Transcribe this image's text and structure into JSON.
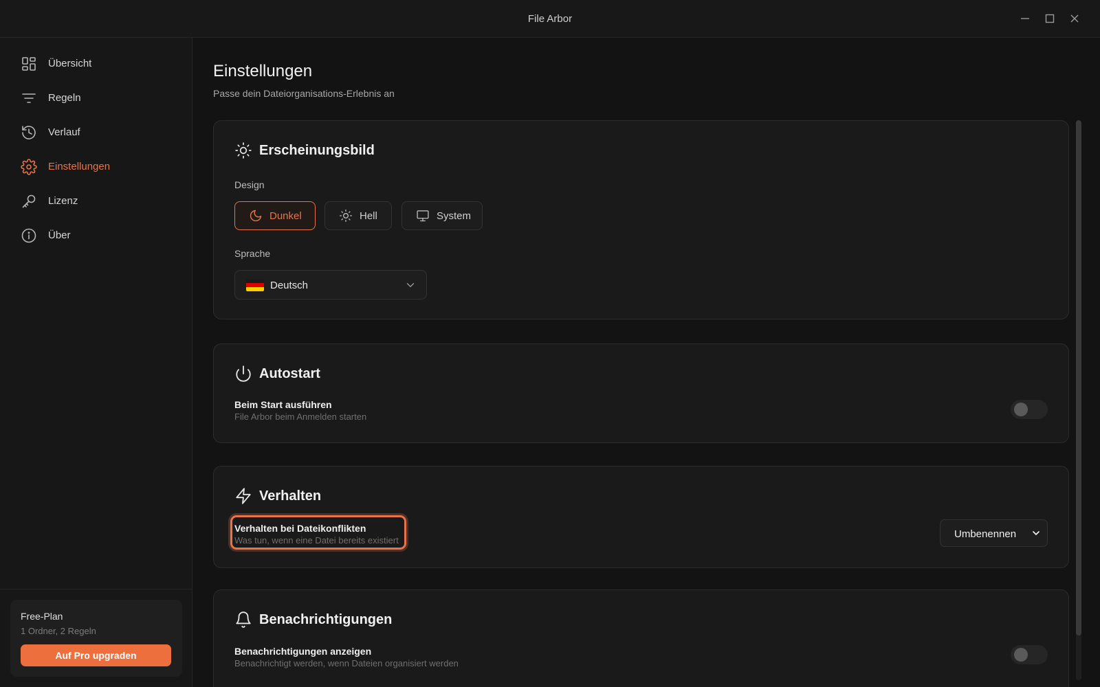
{
  "window": {
    "title": "File Arbor"
  },
  "sidebar": {
    "items": [
      {
        "label": "Übersicht",
        "icon": "grid-icon",
        "active": false
      },
      {
        "label": "Regeln",
        "icon": "filter-icon",
        "active": false
      },
      {
        "label": "Verlauf",
        "icon": "history-icon",
        "active": false
      },
      {
        "label": "Einstellungen",
        "icon": "gear-icon",
        "active": true
      },
      {
        "label": "Lizenz",
        "icon": "key-icon",
        "active": false
      },
      {
        "label": "Über",
        "icon": "info-icon",
        "active": false
      }
    ],
    "plan": {
      "title": "Free-Plan",
      "usage": "1 Ordner, 2 Regeln",
      "upgrade_label": "Auf Pro upgraden"
    }
  },
  "page": {
    "title": "Einstellungen",
    "subtitle": "Passe dein Dateiorganisations-Erlebnis an"
  },
  "appearance": {
    "heading": "Erscheinungsbild",
    "design_label": "Design",
    "themes": [
      {
        "label": "Dunkel",
        "icon": "moon-icon",
        "selected": true
      },
      {
        "label": "Hell",
        "icon": "sun-icon",
        "selected": false
      },
      {
        "label": "System",
        "icon": "monitor-icon",
        "selected": false
      }
    ],
    "language_label": "Sprache",
    "language_value": "Deutsch",
    "language_flag": "german-flag-icon"
  },
  "autostart": {
    "heading": "Autostart",
    "run_title": "Beim Start ausführen",
    "run_desc": "File Arbor beim Anmelden starten",
    "run_enabled": false
  },
  "behavior": {
    "heading": "Verhalten",
    "conflict_title": "Verhalten bei Dateikonflikten",
    "conflict_desc": "Was tun, wenn eine Datei bereits existiert",
    "conflict_value": "Umbenennen"
  },
  "notifications": {
    "heading": "Benachrichtigungen",
    "show_title": "Benachrichtigungen anzeigen",
    "show_desc": "Benachrichtigt werden, wenn Dateien organisiert werden",
    "show_enabled": false
  },
  "colors": {
    "accent": "#e8734a",
    "background": "#131313",
    "card": "#1a1a1a"
  }
}
